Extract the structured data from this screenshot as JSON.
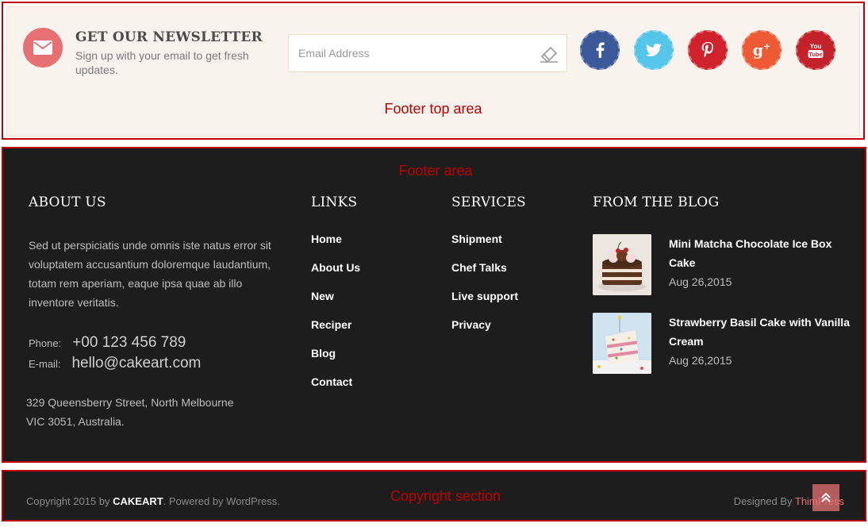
{
  "footer_top": {
    "icon": "envelope-icon",
    "newsletter_title": "GET OUR NEWSLETTER",
    "newsletter_subtitle": "Sign up with your email to get fresh updates.",
    "email_placeholder": "Email Address",
    "email_value": "",
    "submit_icon": "send-icon",
    "social": [
      {
        "name": "facebook",
        "glyph": "f",
        "color": "#3b5998"
      },
      {
        "name": "twitter",
        "glyph": "bird",
        "color": "#55c5ea"
      },
      {
        "name": "pinterest",
        "glyph": "p",
        "color": "#d0222c"
      },
      {
        "name": "google-plus",
        "glyph": "g+",
        "color": "#ee5a33"
      },
      {
        "name": "youtube",
        "glyph": "yt",
        "color": "#c4222a"
      }
    ],
    "annotation": "Footer top area"
  },
  "footer_main": {
    "annotation": "Footer area",
    "about": {
      "heading": "ABOUT US",
      "text": "Sed ut perspiciatis unde omnis iste natus error sit voluptatem accusantium doloremque laudantium, totam rem aperiam, eaque ipsa quae ab illo inventore veritatis.",
      "phone_label": "Phone:",
      "phone": "+00 123 456 789",
      "email_label": "E-mail:",
      "email": "hello@cakeart.com",
      "address_line1": "329 Queensberry Street, North Melbourne",
      "address_line2": "VIC 3051, Australia."
    },
    "links": {
      "heading": "LINKS",
      "items": [
        "Home",
        "About Us",
        "New",
        "Reciper",
        "Blog",
        "Contact"
      ]
    },
    "services": {
      "heading": "SERVICES",
      "items": [
        "Shipment",
        "Chef Talks",
        "Live support",
        "Privacy"
      ]
    },
    "blog": {
      "heading": "FROM THE BLOG",
      "posts": [
        {
          "title": "Mini Matcha Chocolate Ice Box Cake",
          "date": "Aug 26,2015"
        },
        {
          "title": "Strawberry Basil Cake with Vanilla Cream",
          "date": "Aug 26,2015"
        }
      ]
    }
  },
  "copyright": {
    "text_before": "Copyright 2015 by ",
    "brand": "CAKEART",
    "text_after": ". Powered by WordPress.",
    "annotation": "Copyright section",
    "designed_by": "Designed By ",
    "author": "ThimPress",
    "to_top_icon": "double-chevron-up-icon"
  },
  "colors": {
    "accent": "#e67073",
    "annotation_red": "#c00000",
    "footer_bg": "#1d1d1d",
    "top_bg": "#f9f3ee"
  }
}
